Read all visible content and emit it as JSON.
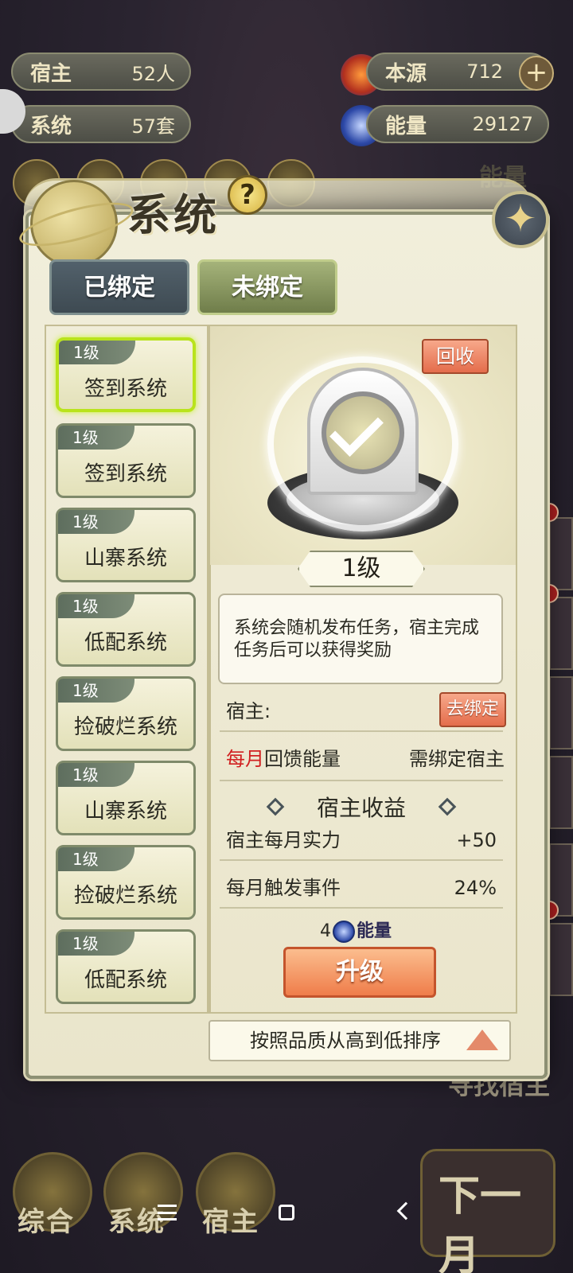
{
  "hud": {
    "hosts_label": "宿主",
    "hosts_value": "52人",
    "systems_label": "系统",
    "systems_value": "57套",
    "origin_label": "本源",
    "origin_value": "712",
    "energy_label": "能量",
    "energy_value": "29127"
  },
  "background": {
    "energy_tab": "能量",
    "find_host": "寻找宿主",
    "next_month": "下一月",
    "bottom_nav": [
      "综合",
      "系统",
      "宿主"
    ]
  },
  "dialog": {
    "title": "系统",
    "help": "?",
    "tabs": {
      "bound": "已绑定",
      "unbound": "未绑定"
    },
    "list": [
      {
        "level": "1级",
        "name": "签到系统",
        "selected": true
      },
      {
        "level": "1级",
        "name": "签到系统"
      },
      {
        "level": "1级",
        "name": "山寨系统"
      },
      {
        "level": "1级",
        "name": "低配系统"
      },
      {
        "level": "1级",
        "name": "捡破烂系统"
      },
      {
        "level": "1级",
        "name": "山寨系统"
      },
      {
        "level": "1级",
        "name": "捡破烂系统"
      },
      {
        "level": "1级",
        "name": "低配系统"
      }
    ],
    "detail": {
      "recycle": "回收",
      "level": "1级",
      "description": "系统会随机发布任务，宿主完成任务后可以获得奖励",
      "host_label": "宿主:",
      "unbind": "去绑定",
      "monthly_prefix": "每月",
      "monthly_text": "回馈能量",
      "monthly_value": "需绑定宿主",
      "section_title": "宿主收益",
      "stat1_label": "宿主每月实力",
      "stat1_value": "+50",
      "stat2_label": "每月触发事件",
      "stat2_value": "24%",
      "cost_amount": "4",
      "cost_unit": "能量",
      "upgrade": "升级"
    },
    "sort_label": "按照品质从高到低排序"
  }
}
